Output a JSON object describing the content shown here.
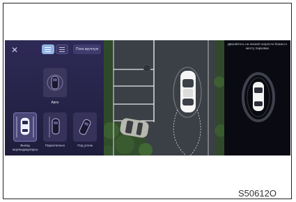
{
  "left_panel": {
    "close_icon": "close-icon",
    "manual_button_label": "Пока вручную",
    "auto_label": "Авто",
    "tiles": [
      {
        "label": "Выезд перпендикулярно",
        "icon": "perpendicular-exit-icon"
      },
      {
        "label": "Параллельно",
        "icon": "parallel-parking-icon"
      },
      {
        "label": "Под углом",
        "icon": "angled-parking-icon"
      }
    ]
  },
  "right_panel": {
    "hint": "Двигайтесь на низкой скорости близко к месту парковки"
  },
  "caption": "S50612O",
  "colors": {
    "panel_bg": "#2a2750",
    "active_mode": "#8fb2e8",
    "asphalt": "#3b3f46"
  }
}
